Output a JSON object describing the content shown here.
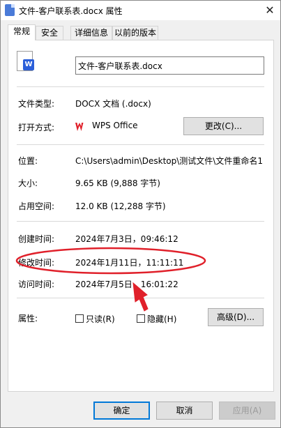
{
  "window": {
    "title": "文件-客户联系表.docx 属性",
    "close_glyph": "✕"
  },
  "tabs": [
    {
      "label": "常规",
      "active": true
    },
    {
      "label": "安全",
      "active": false
    },
    {
      "label": "详细信息",
      "active": false
    },
    {
      "label": "以前的版本",
      "active": false
    }
  ],
  "general": {
    "filename": "文件-客户联系表.docx",
    "file_type_label": "文件类型:",
    "file_type_value": "DOCX 文档 (.docx)",
    "open_with_label": "打开方式:",
    "open_with_value": "WPS Office",
    "change_button": "更改(C)...",
    "location_label": "位置:",
    "location_value": "C:\\Users\\admin\\Desktop\\测试文件\\文件重命名1",
    "size_label": "大小:",
    "size_value": "9.65 KB (9,888 字节)",
    "size_on_disk_label": "占用空间:",
    "size_on_disk_value": "12.0 KB (12,288 字节)",
    "created_label": "创建时间:",
    "created_value": "2024年7月3日，09:46:12",
    "modified_label": "修改时间:",
    "modified_value": "2024年1月11日，11:11:11",
    "accessed_label": "访问时间:",
    "accessed_value": "2024年7月5日，16:01:22",
    "attributes_label": "属性:",
    "readonly_label": "只读(R)",
    "hidden_label": "隐藏(H)",
    "advanced_button": "高级(D)..."
  },
  "footer": {
    "ok": "确定",
    "cancel": "取消",
    "apply": "应用(A)"
  },
  "colors": {
    "annotation": "#e0202a",
    "accent": "#0078d7",
    "word_icon": "#2b5fd9"
  },
  "icons": {
    "doc": "word-document-icon",
    "wps": "wps-logo-icon"
  }
}
